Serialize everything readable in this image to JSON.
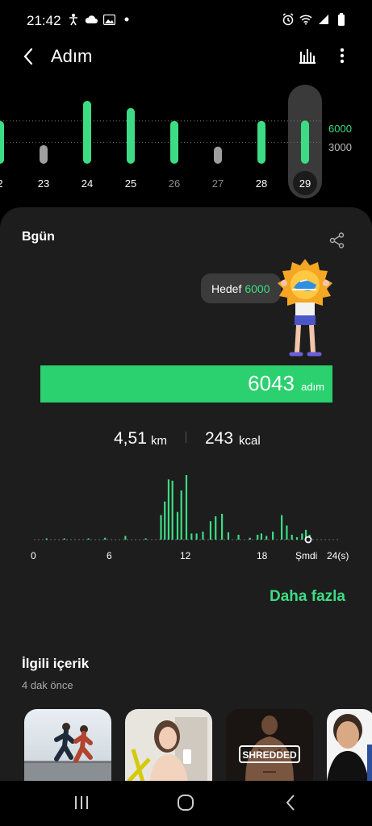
{
  "status_bar": {
    "time": "21:42",
    "icons_left": [
      "accessibility-icon",
      "cloud-icon",
      "image-icon",
      "dot-icon"
    ],
    "icons_right": [
      "alarm-icon",
      "wifi-icon",
      "signal-icon",
      "battery-icon"
    ]
  },
  "header": {
    "title": "Adım",
    "back_icon": "chevron-left-icon",
    "chart_icon": "bar-chart-icon",
    "more_icon": "more-vertical-icon"
  },
  "week_chart": {
    "goal_high_label": "6000",
    "goal_low_label": "3000",
    "days": [
      {
        "label": "2",
        "value": 6000,
        "goal_met": true
      },
      {
        "label": "23",
        "value": 2600,
        "goal_met": false
      },
      {
        "label": "24",
        "value": 8800,
        "goal_met": true
      },
      {
        "label": "25",
        "value": 7800,
        "goal_met": true
      },
      {
        "label": "26",
        "value": 6000,
        "goal_met": true
      },
      {
        "label": "27",
        "value": 2400,
        "goal_met": false
      },
      {
        "label": "28",
        "value": 6000,
        "goal_met": true
      },
      {
        "label": "29",
        "value": 6043,
        "goal_met": true,
        "selected": true
      }
    ],
    "colors": {
      "met": "#3ddc84",
      "unmet": "#9e9e9e",
      "selected_bg": "#3a3a3a"
    }
  },
  "today_card": {
    "title": "Bgün",
    "share_icon": "share-icon",
    "goal_prefix": "Hedef",
    "goal_value": "6000",
    "steps_value": "6043",
    "steps_unit": "adım",
    "progress_fraction": 1.0,
    "distance_value": "4,51",
    "distance_unit": "km",
    "calories_value": "243",
    "calories_unit": "kcal"
  },
  "chart_data": {
    "type": "bar",
    "x_ticks": [
      "0",
      "6",
      "12",
      "18",
      "Şmdi",
      "24(s)"
    ],
    "xlim": [
      0,
      24
    ],
    "series": [
      {
        "values": [
          [
            1.0,
            2
          ],
          [
            2.4,
            2
          ],
          [
            4.3,
            2
          ],
          [
            5.6,
            3
          ],
          [
            7.2,
            6
          ],
          [
            8.8,
            2
          ],
          [
            10.0,
            40
          ],
          [
            10.3,
            62
          ],
          [
            10.6,
            98
          ],
          [
            10.9,
            96
          ],
          [
            11.3,
            45
          ],
          [
            11.6,
            80
          ],
          [
            12.0,
            105
          ],
          [
            12.4,
            10
          ],
          [
            12.8,
            10
          ],
          [
            13.3,
            13
          ],
          [
            13.9,
            30
          ],
          [
            14.3,
            38
          ],
          [
            14.8,
            42
          ],
          [
            15.3,
            12
          ],
          [
            16.1,
            8
          ],
          [
            17.0,
            3
          ],
          [
            17.6,
            8
          ],
          [
            17.9,
            10
          ],
          [
            18.3,
            6
          ],
          [
            18.8,
            13
          ],
          [
            19.5,
            40
          ],
          [
            19.9,
            23
          ],
          [
            20.3,
            8
          ],
          [
            20.7,
            4
          ],
          [
            21.1,
            10
          ],
          [
            21.4,
            16
          ],
          [
            21.7,
            8
          ]
        ]
      }
    ],
    "bar_color": "#3ddc84",
    "baseline_color": "#666666"
  },
  "more_link": "Daha fazla",
  "related": {
    "title": "İlgili içerik",
    "subtitle": "4 dak önce",
    "thumb_badge": "SHREDDED"
  },
  "nav_bar": {
    "recents_icon": "recents-icon",
    "home_icon": "home-icon",
    "back_icon": "back-icon"
  }
}
